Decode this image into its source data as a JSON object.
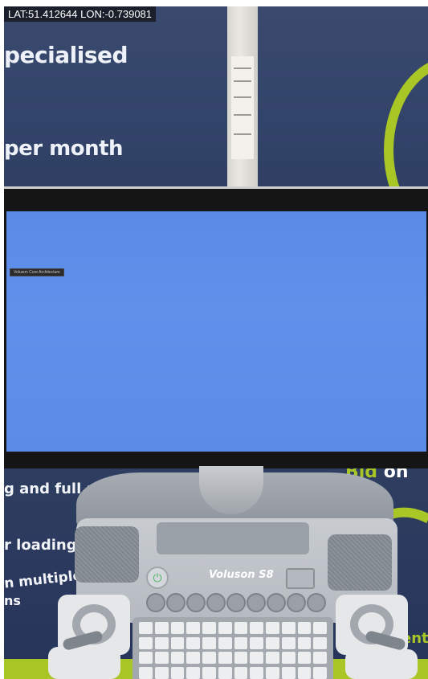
{
  "gps_overlay": {
    "text": "LAT:51.412644 LON:-0.739081"
  },
  "banner_top": {
    "line1": "pecialised",
    "line2": "per month"
  },
  "monitor": {
    "label": "Voluson Core Architecture"
  },
  "banner_bottom": {
    "bid_word": "Bid",
    "bid_rest": " on th",
    "line1": "g and full aft",
    "line2": "r loading",
    "line3": "n multiple Eu",
    "line4": "ns",
    "line5": "ent"
  },
  "device": {
    "brand": "Voluson S8"
  },
  "colors": {
    "banner_navy": "#33446a",
    "accent_green": "#a9c627",
    "screen_blue": "#5f90ea"
  }
}
